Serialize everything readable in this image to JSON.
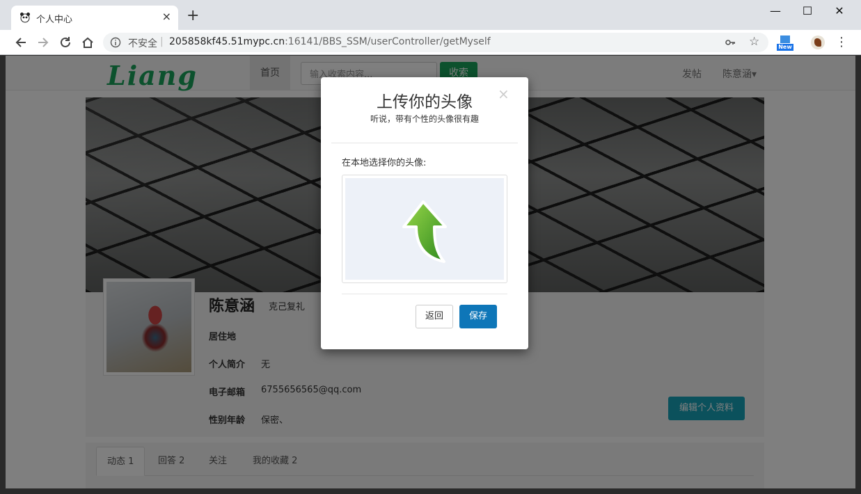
{
  "browser": {
    "tab_title": "个人中心",
    "tab_close": "×",
    "new_tab": "+",
    "window_controls": {
      "minimize": "—",
      "maximize": "☐",
      "close": "✕"
    },
    "security_label": "不安全",
    "url_host": "205858kf45.51mypc.cn",
    "url_rest": ":16141/BBS_SSM/userController/getMyself",
    "extension_badge": "New"
  },
  "site": {
    "logo": "Liang",
    "nav_home": "首页",
    "search_placeholder": "输入收索内容...",
    "search_button": "收索",
    "nav_post": "发帖",
    "nav_user": "陈意涵▾"
  },
  "profile": {
    "name": "陈意涵",
    "motto": "克己复礼",
    "fields": [
      {
        "label": "居住地",
        "value": ""
      },
      {
        "label": "个人简介",
        "value": "无"
      },
      {
        "label": "电子邮箱",
        "value": "6755656565@qq.com"
      },
      {
        "label": "性别年龄",
        "value": "保密、"
      }
    ],
    "edit_button": "编辑个人资料",
    "tabs": [
      {
        "label": "动态 1"
      },
      {
        "label": "回答 2"
      },
      {
        "label": "关注"
      },
      {
        "label": "我的收藏 2"
      }
    ]
  },
  "modal": {
    "title": "上传你的头像",
    "subtitle": "听说，带有个性的头像很有趣",
    "close": "×",
    "select_label": "在本地选择你的头像:",
    "back_button": "返回",
    "save_button": "保存"
  },
  "colors": {
    "brand_green": "#19a25a",
    "save_blue": "#0e76b8",
    "edit_teal": "#17a2b8"
  }
}
